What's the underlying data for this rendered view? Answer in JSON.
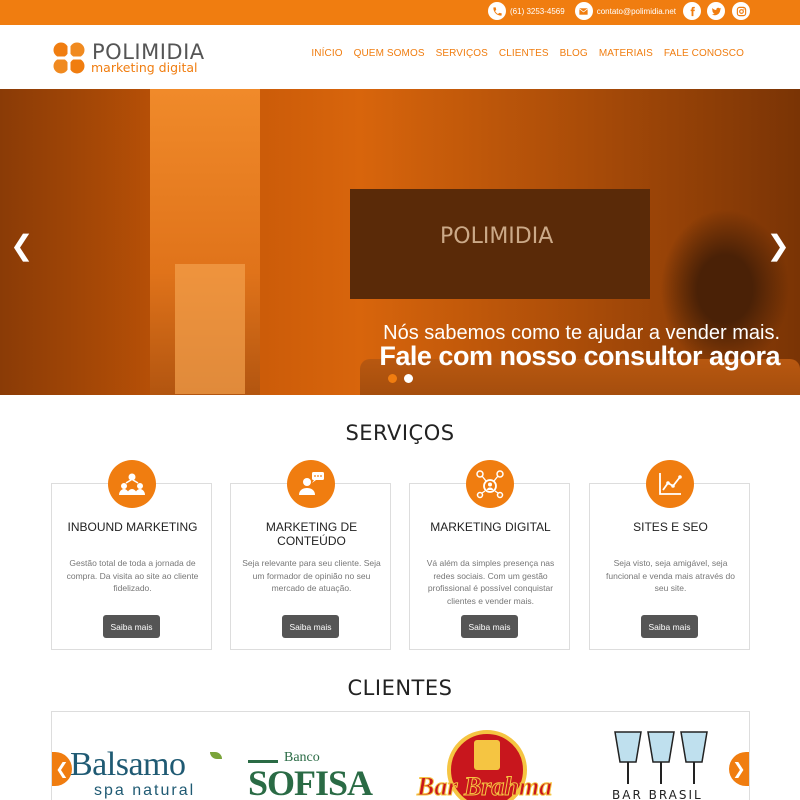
{
  "topbar": {
    "phone": "(61) 3253-4569",
    "email": "contato@polimidia.net",
    "social": [
      "facebook-icon",
      "twitter-icon",
      "instagram-icon"
    ],
    "color": "#f07d10"
  },
  "header": {
    "brand": "POLIMIDIA",
    "tagline": "marketing digital",
    "nav": [
      "INÍCIO",
      "QUEM SOMOS",
      "SERVIÇOS",
      "CLIENTES",
      "BLOG",
      "MATERIAIS",
      "FALE CONOSCO"
    ]
  },
  "hero": {
    "sign": "POLIMIDIA",
    "line1": "Nós sabemos como te ajudar a vender mais.",
    "line2": "Fale com nosso consultor agora",
    "slides": 2,
    "active_slide": 1
  },
  "services": {
    "title": "SERVIÇOS",
    "items": [
      {
        "title": "INBOUND MARKETING",
        "desc": "Gestão total de toda a jornada de compra. Da visita ao site ao cliente fidelizado.",
        "button": "Saiba mais",
        "icon": "people-network-icon"
      },
      {
        "title": "MARKETING DE CONTEÚDO",
        "desc": "Seja relevante para seu cliente. Seja um formador de opinião no seu mercado de atuação.",
        "button": "Saiba mais",
        "icon": "speaker-chat-icon"
      },
      {
        "title": "MARKETING DIGITAL",
        "desc": "Vá além da simples presença nas redes sociais. Com um gestão profissional é possível conquistar clientes e vender mais.",
        "button": "Saiba mais",
        "icon": "social-network-icon"
      },
      {
        "title": "SITES E SEO",
        "desc": "Seja visto, seja amigável, seja funcional e venda mais através do seu site.",
        "button": "Saiba mais",
        "icon": "growth-chart-icon"
      }
    ]
  },
  "clients": {
    "title": "CLIENTES",
    "logos": [
      {
        "name": "Balsamo",
        "sub": "spa natural"
      },
      {
        "name": "SOFISA",
        "sub": "Banco"
      },
      {
        "name": "Bar Brahma",
        "sub": ""
      },
      {
        "name": "BAR BRASIL",
        "sub": ""
      }
    ]
  }
}
